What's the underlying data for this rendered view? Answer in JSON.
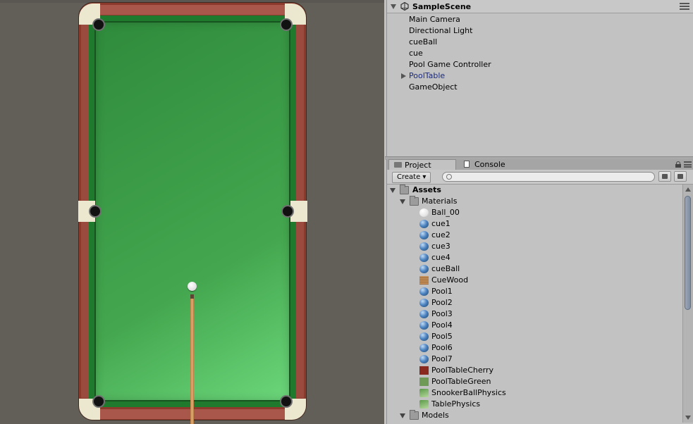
{
  "hierarchy": {
    "scene_title": "SampleScene",
    "items": [
      {
        "label": "Main Camera"
      },
      {
        "label": "Directional Light"
      },
      {
        "label": "cueBall"
      },
      {
        "label": "cue"
      },
      {
        "label": "Pool Game Controller"
      },
      {
        "label": "PoolTable"
      },
      {
        "label": "GameObject"
      }
    ]
  },
  "project": {
    "tabs": [
      {
        "label": "Project",
        "icon": "folder-icon"
      },
      {
        "label": "Console",
        "icon": "console-icon"
      }
    ],
    "create_label": "Create",
    "search": {
      "value": "",
      "placeholder": ""
    },
    "tree": {
      "assets_label": "Assets",
      "materials_label": "Materials",
      "models_label": "Models",
      "materials": [
        {
          "label": "Ball_00",
          "icon": "white-sphere-icon"
        },
        {
          "label": "cue1",
          "icon": "material-sphere-icon"
        },
        {
          "label": "cue2",
          "icon": "material-sphere-icon"
        },
        {
          "label": "cue3",
          "icon": "material-sphere-icon"
        },
        {
          "label": "cue4",
          "icon": "material-sphere-icon"
        },
        {
          "label": "cueBall",
          "icon": "material-sphere-icon"
        },
        {
          "label": "CueWood",
          "icon": "wood-texture-icon"
        },
        {
          "label": "Pool1",
          "icon": "material-sphere-icon"
        },
        {
          "label": "Pool2",
          "icon": "material-sphere-icon"
        },
        {
          "label": "Pool3",
          "icon": "material-sphere-icon"
        },
        {
          "label": "Pool4",
          "icon": "material-sphere-icon"
        },
        {
          "label": "Pool5",
          "icon": "material-sphere-icon"
        },
        {
          "label": "Pool6",
          "icon": "material-sphere-icon"
        },
        {
          "label": "Pool7",
          "icon": "material-sphere-icon"
        },
        {
          "label": "PoolTableCherry",
          "icon": "cherry-texture-icon"
        },
        {
          "label": "PoolTableGreen",
          "icon": "green-texture-icon"
        },
        {
          "label": "SnookerBallPhysics",
          "icon": "physics-material-icon"
        },
        {
          "label": "TablePhysics",
          "icon": "physics-material-icon"
        }
      ]
    }
  },
  "colors": {
    "game_bg": "#625e58",
    "felt": "#3a9a46",
    "rail": "#8c3a2b",
    "panel_bg": "#c2c2c2",
    "link_text": "#1b2a7e"
  }
}
